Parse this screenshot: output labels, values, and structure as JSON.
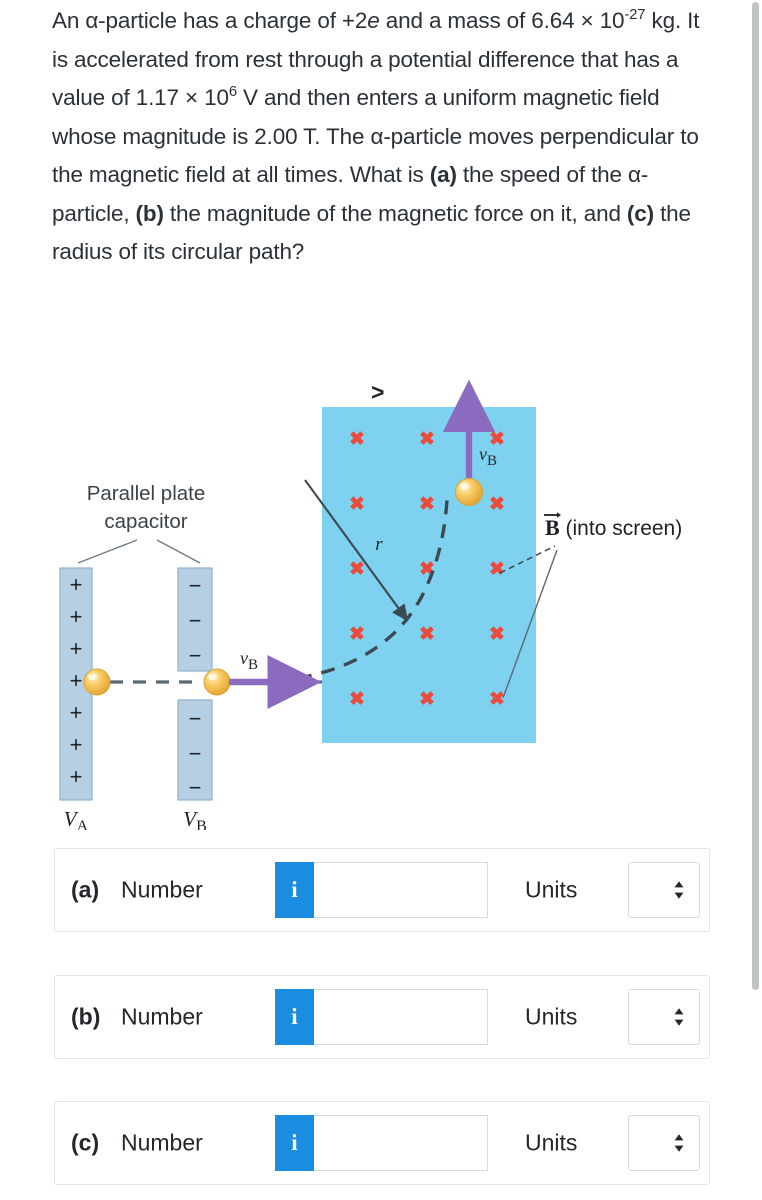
{
  "problem": {
    "line1_a": "An α-particle has a charge of ",
    "line1_plus2": "+2",
    "line1_e": "e",
    "line1_b": " and a mass of 6.64 × 10",
    "exp1": "-27",
    "line1_c": " kg. It is accelerated from rest through a potential difference that has a value of 1.17 × 10",
    "exp2": "6",
    "line1_d": " V and then enters a uniform magnetic field whose magnitude is 2.00 T. The α-particle moves perpendicular to the magnetic field at all times. What is ",
    "label_a": "(a)",
    "line1_e2": " the speed of the α-particle, ",
    "label_b": "(b)",
    "line1_f": " the magnitude of the magnetic force on it, and ",
    "label_c": "(c)",
    "line1_g": " the radius of its circular path?"
  },
  "figure": {
    "capacitor_label_line1": "Parallel plate",
    "capacitor_label_line2": "capacitor",
    "plate_a_label": "V",
    "plate_a_sub": "A",
    "plate_b_label": "V",
    "plate_b_sub": "B",
    "plus_sign": "+",
    "minus_sign": "−",
    "plus_count": 7,
    "minus_count_upper": 3,
    "minus_count_lower": 3,
    "velocity_label": "v",
    "velocity_sub": "B",
    "radius_label": "r",
    "field_label_vector": "B",
    "field_label_text": " (into screen)",
    "caret_marker": ">",
    "cross_marker": "✖",
    "cross_rows": 5,
    "cross_cols": 3,
    "colors": {
      "field_region": "#7ed2f0",
      "cross": "#ea4b3c",
      "plate_fill": "#b6cfe2",
      "plate_stroke": "#8fb2cc",
      "particle": "#f6c253",
      "particle_edge": "#e0a63a",
      "velocity_arrow": "#8b6bbf",
      "trajectory": "#3d4a52",
      "leader_line": "#6b7a85"
    }
  },
  "answers": {
    "number_label": "Number",
    "units_label": "Units",
    "info_glyph": "i",
    "input_value": "",
    "input_placeholder": "",
    "rows": [
      {
        "letter": "(a)"
      },
      {
        "letter": "(b)"
      },
      {
        "letter": "(c)"
      }
    ]
  }
}
